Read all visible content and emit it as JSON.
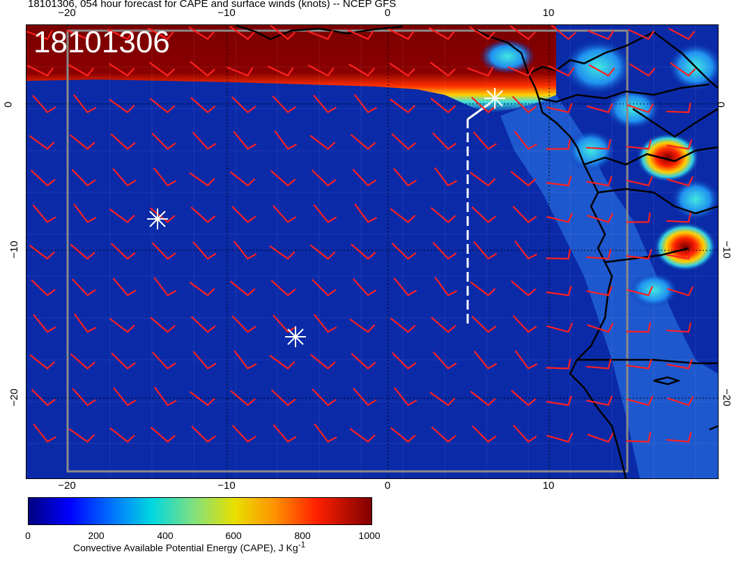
{
  "title": "18101306, 054 hour forecast for CAPE and surface winds (knots) -- NCEP GFS",
  "stamp": "18101306",
  "axes": {
    "lon_ticks": [
      "−20",
      "−10",
      "0",
      "10"
    ],
    "lat_ticks": [
      "0",
      "−10",
      "−20"
    ]
  },
  "colorbar": {
    "ticks": [
      "0",
      "200",
      "400",
      "600",
      "800",
      "1000"
    ],
    "label_main": "Convective Available Potential Energy (CAPE), J Kg",
    "label_sup": "-1",
    "range": [
      0,
      1000
    ],
    "colors": [
      "#00007f",
      "#0000ff",
      "#0070ff",
      "#00d8e0",
      "#7fe080",
      "#e8e000",
      "#ff9000",
      "#ff2000",
      "#7f0000"
    ]
  },
  "map": {
    "ocean_color": "#0a2aa8",
    "coast_color": "#000000",
    "barb_color": "#ff2020",
    "markers": [
      "asterisk",
      "asterisk",
      "asterisk"
    ]
  }
}
